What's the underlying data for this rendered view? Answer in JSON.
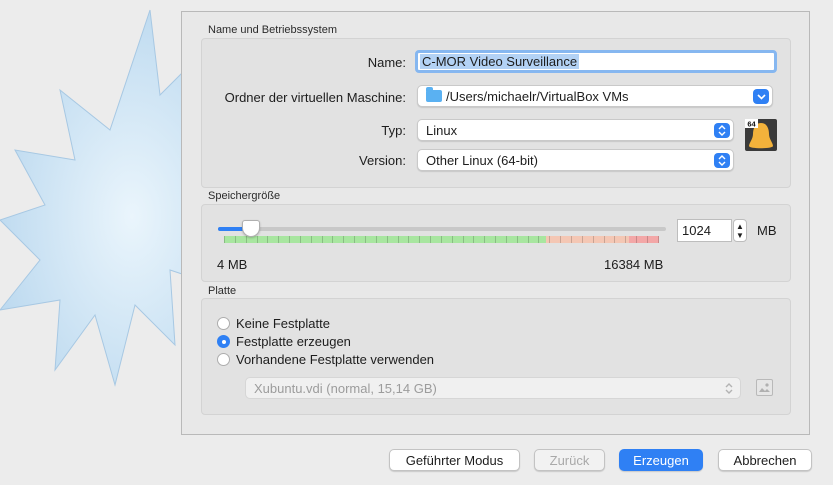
{
  "name_section": {
    "title": "Name und Betriebssystem",
    "name_label": "Name:",
    "name_value": "C-MOR Video Surveillance",
    "folder_label": "Ordner der virtuellen Maschine:",
    "folder_value": "/Users/michaelr/VirtualBox VMs",
    "type_label": "Typ:",
    "type_value": "Linux",
    "version_label": "Version:",
    "version_value": "Other Linux (64-bit)",
    "os_badge": "64"
  },
  "memory_section": {
    "title": "Speichergröße",
    "value": "1024",
    "unit": "MB",
    "min_label": "4 MB",
    "max_label": "16384 MB"
  },
  "disk_section": {
    "title": "Platte",
    "options": [
      {
        "label": "Keine Festplatte",
        "selected": false
      },
      {
        "label": "Festplatte erzeugen",
        "selected": true
      },
      {
        "label": "Vorhandene Festplatte verwenden",
        "selected": false
      }
    ],
    "existing_disk": "Xubuntu.vdi (normal, 15,14 GB)"
  },
  "buttons": {
    "guided": "Geführter Modus",
    "back": "Zurück",
    "create": "Erzeugen",
    "cancel": "Abbrechen"
  },
  "icons": {
    "folder": "folder-icon",
    "os": "linux-tux-icon",
    "popup_arrow": "chevron-updown-icon",
    "disk_picker": "disk-folder-icon"
  },
  "colors": {
    "accent": "#2f80f4",
    "selection": "#b3d2f5",
    "scale_green": "#a8e6a0",
    "scale_orange": "#f4c7b4",
    "scale_red": "#f3a7a7"
  }
}
